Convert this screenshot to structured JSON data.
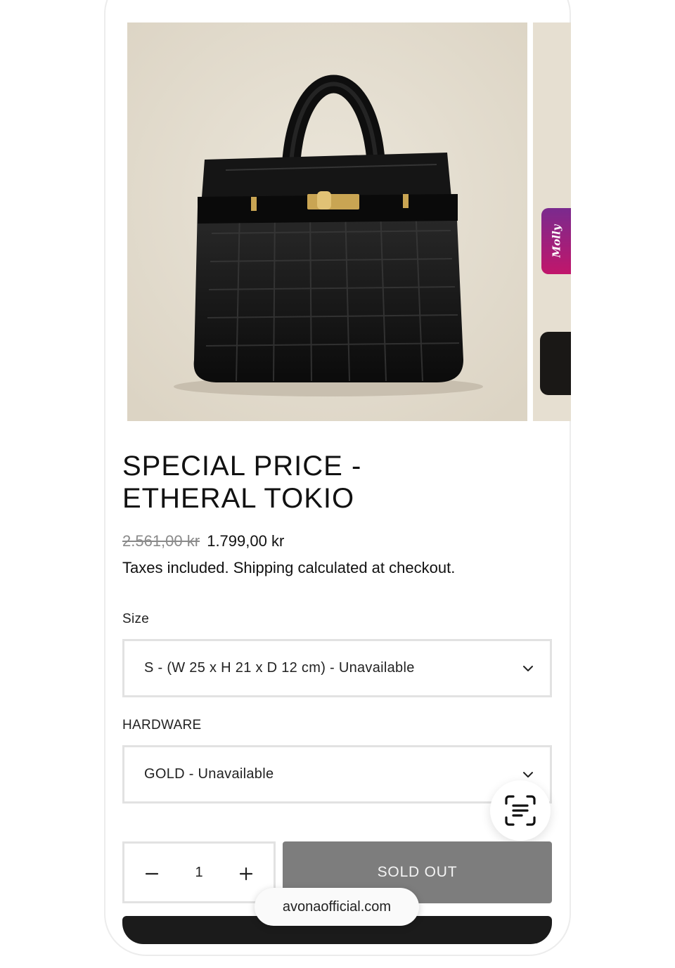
{
  "product": {
    "title_line1": "SPECIAL PRICE -",
    "title_line2": "ETHERAL TOKIO",
    "old_price": "2.561,00 kr",
    "price": "1.799,00 kr",
    "tax_note": "Taxes included. Shipping calculated at checkout."
  },
  "gallery": {
    "main_image": "black-crocodile-handbag-photo",
    "next_image": "next-product-photo-partial"
  },
  "molly_tab": {
    "label": "Molly"
  },
  "options": {
    "size": {
      "label": "Size",
      "value": "S - (W 25 x H 21 x D 12 cm) - Unavailable"
    },
    "hardware": {
      "label": "HARDWARE",
      "value": "GOLD - Unavailable"
    }
  },
  "quantity": {
    "value": "1"
  },
  "buttons": {
    "sold_out": "SOLD OUT"
  },
  "browser": {
    "url": "avonaofficial.com"
  },
  "icons": {
    "chevron": "chevron-down-icon",
    "scan": "scan-text-icon",
    "minus": "minus-icon",
    "plus": "plus-icon"
  },
  "colors": {
    "sold_out_bg": "#7d7d7d",
    "molly_gradient_top": "#7a2a8e",
    "molly_gradient_bottom": "#c1166b",
    "image_bg": "#e4ddd0"
  }
}
